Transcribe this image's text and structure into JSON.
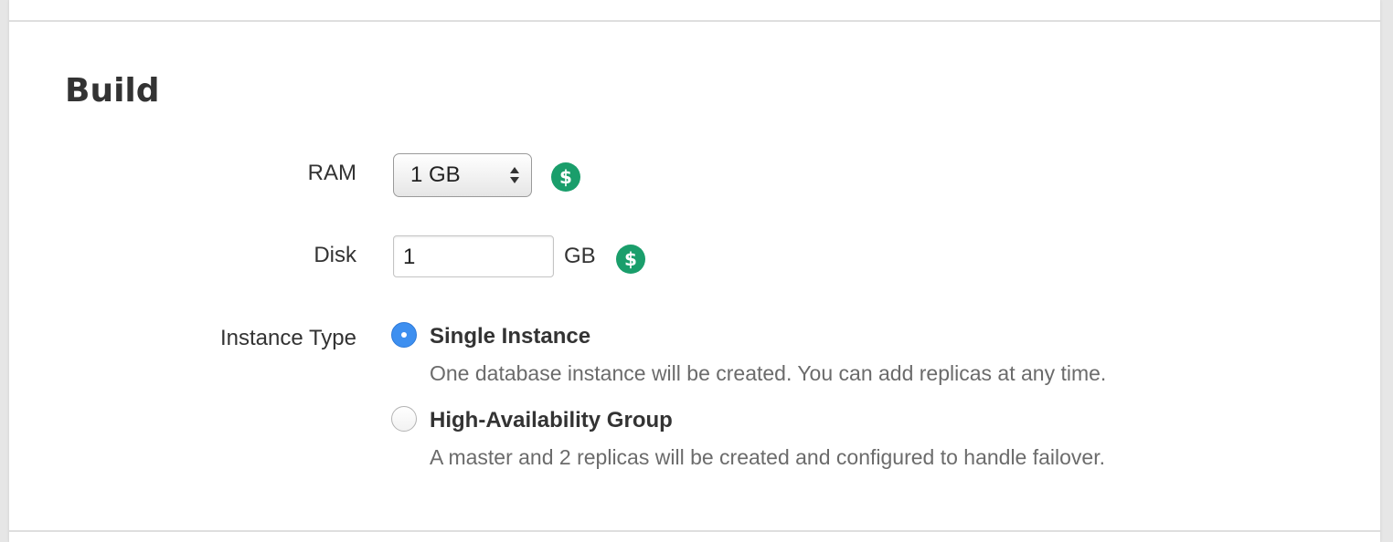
{
  "section": {
    "title": "Build"
  },
  "ram": {
    "label": "RAM",
    "selected_value": "1 GB",
    "price_icon": "dollar-circle-icon"
  },
  "disk": {
    "label": "Disk",
    "value": "1",
    "unit": "GB",
    "price_icon": "dollar-circle-icon"
  },
  "instance_type": {
    "label": "Instance Type",
    "options": [
      {
        "title": "Single Instance",
        "description": "One database instance will be created. You can add replicas at any time.",
        "selected": true
      },
      {
        "title": "High-Availability Group",
        "description": "A master and 2 replicas will be created and configured to handle failover.",
        "selected": false
      }
    ]
  },
  "icons": {
    "dollar_symbol": "$"
  },
  "colors": {
    "price_badge": "#1a9e6b",
    "radio_selected": "#3d8ff0",
    "text_primary": "#333333",
    "text_secondary": "#6b6b6b"
  }
}
